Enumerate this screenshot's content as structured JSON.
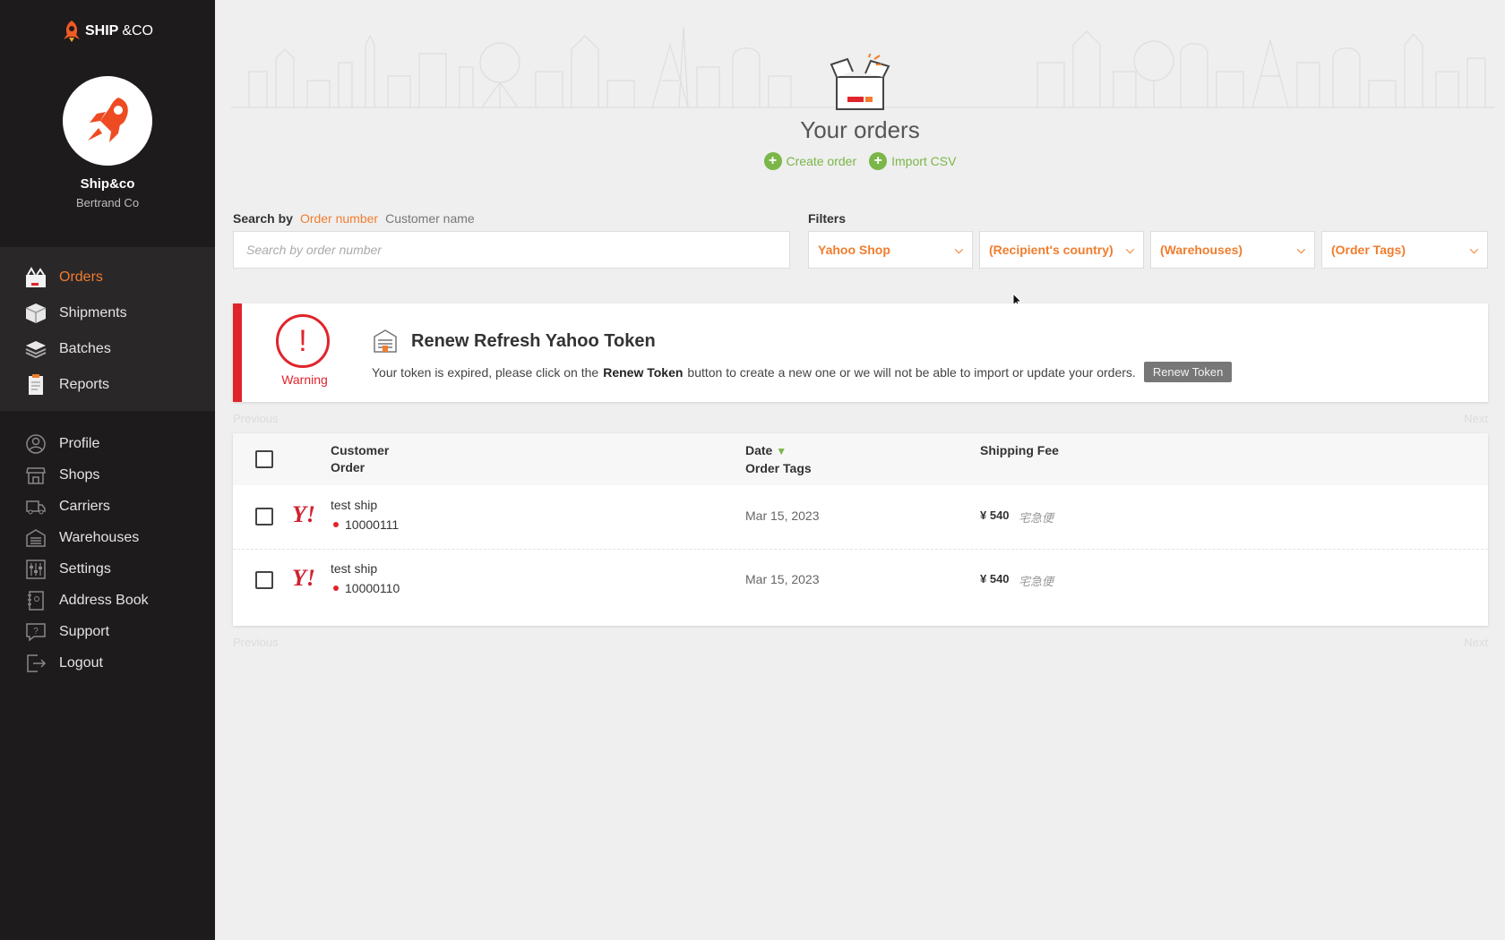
{
  "brand": {
    "logo_main": "SHIP",
    "logo_co": "&CO"
  },
  "account": {
    "name": "Ship&co",
    "company": "Bertrand Co"
  },
  "nav_main": [
    {
      "label": "Orders",
      "icon": "orders-icon",
      "active": true
    },
    {
      "label": "Shipments",
      "icon": "shipments-icon"
    },
    {
      "label": "Batches",
      "icon": "batches-icon"
    },
    {
      "label": "Reports",
      "icon": "reports-icon"
    }
  ],
  "nav_secondary": [
    {
      "label": "Profile",
      "icon": "profile-icon"
    },
    {
      "label": "Shops",
      "icon": "shops-icon"
    },
    {
      "label": "Carriers",
      "icon": "carriers-icon"
    },
    {
      "label": "Warehouses",
      "icon": "warehouses-icon"
    },
    {
      "label": "Settings",
      "icon": "settings-icon"
    },
    {
      "label": "Address Book",
      "icon": "address-book-icon"
    },
    {
      "label": "Support",
      "icon": "support-icon"
    },
    {
      "label": "Logout",
      "icon": "logout-icon"
    }
  ],
  "header": {
    "title": "Your orders",
    "create_order": "Create order",
    "import_csv": "Import CSV"
  },
  "search": {
    "label": "Search by",
    "option_active": "Order number",
    "option_other": "Customer name",
    "placeholder": "Search by order number"
  },
  "filters": {
    "label": "Filters",
    "shop": "Yahoo Shop",
    "country": "(Recipient's country)",
    "warehouses": "(Warehouses)",
    "tags": "(Order Tags)"
  },
  "warning": {
    "label": "Warning",
    "title": "Renew Refresh Yahoo Token",
    "body_before": "Your token is expired, please click on the",
    "body_bold": "Renew Token",
    "body_after": "button to create a new one or we will not be able to import or update your orders.",
    "button": "Renew Token"
  },
  "pager": {
    "previous": "Previous",
    "next": "Next"
  },
  "table": {
    "headers": {
      "customer": "Customer",
      "order": "Order",
      "date": "Date",
      "order_tags": "Order Tags",
      "shipping_fee": "Shipping Fee"
    },
    "rows": [
      {
        "shop_logo": "Y!",
        "customer": "test ship",
        "order_number": "10000111",
        "date": "Mar 15, 2023",
        "fee": "¥ 540",
        "service": "宅急便"
      },
      {
        "shop_logo": "Y!",
        "customer": "test ship",
        "order_number": "10000110",
        "date": "Mar 15, 2023",
        "fee": "¥ 540",
        "service": "宅急便"
      }
    ]
  },
  "colors": {
    "accent": "#f07d2e",
    "green": "#7ab648",
    "danger": "#e0242b",
    "sidebar": "#1e1b1d"
  }
}
